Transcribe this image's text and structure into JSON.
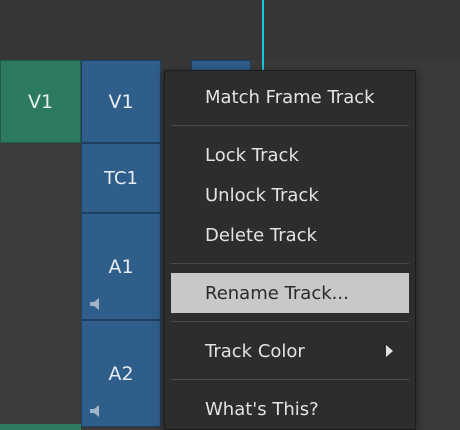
{
  "source_tracks": {
    "v1": "V1"
  },
  "record_tracks": {
    "v1": "V1",
    "tc1": "TC1",
    "a1": "A1",
    "a2": "A2"
  },
  "icons": {
    "speaker": "speaker-icon",
    "submenu": "chevron-right-icon"
  },
  "colors": {
    "source_track": "#2c7a62",
    "record_track": "#2f5e8a",
    "playhead": "#19c6dc",
    "menu_bg": "#2d2d2d",
    "menu_highlight": "#c8c8c8"
  },
  "context_menu": {
    "match_frame": "Match Frame Track",
    "lock": "Lock Track",
    "unlock": "Unlock Track",
    "delete": "Delete Track",
    "rename": "Rename Track...",
    "track_color": "Track Color",
    "whats_this": "What's This?",
    "highlighted": "Rename Track..."
  }
}
